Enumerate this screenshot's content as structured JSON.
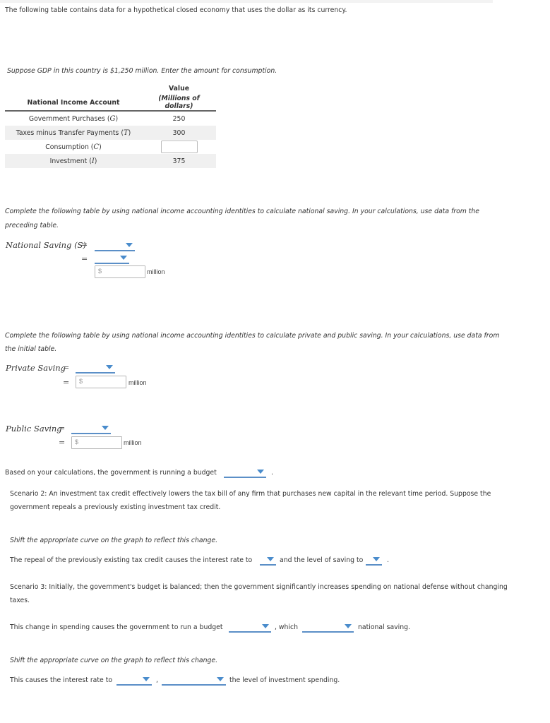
{
  "intro": "The following table contains data for a hypothetical closed economy that uses the dollar as its currency.",
  "gdp_prompt": "Suppose GDP in this country is $1,250 million. Enter the amount for consumption.",
  "table": {
    "header_col1": "National Income Account",
    "header_col2_line1": "Value",
    "header_col2_line2": "(Millions of dollars)",
    "rows": [
      {
        "label": "Government Purchases (",
        "sym": "G",
        "close": ")",
        "value": "250"
      },
      {
        "label": "Taxes minus Transfer Payments (",
        "sym": "T",
        "close": ")",
        "value": "300"
      },
      {
        "label": "Consumption (",
        "sym": "C",
        "close": ")",
        "value": ""
      },
      {
        "label": "Investment (",
        "sym": "I",
        "close": ")",
        "value": "375"
      }
    ]
  },
  "national_saving": {
    "instructions_line1": "Complete the following table by using national income accounting identities to calculate national saving. In your calculations, use data from the",
    "instructions_line2": "preceding table.",
    "label": "National Saving (S)",
    "equals": "=",
    "dollar": "$",
    "unit": "million",
    "input_value": ""
  },
  "private_public": {
    "instructions_line1": "Complete the following table by using national income accounting identities to calculate private and public saving. In your calculations, use data from",
    "instructions_line2": "the initial table.",
    "private_label": "Private Saving",
    "public_label": "Public Saving",
    "equals": "=",
    "dollar": "$",
    "unit": "million"
  },
  "budget": {
    "text": "Based on your calculations, the government is running a budget",
    "end": "."
  },
  "scenario2": {
    "line1": "Scenario 2: An investment tax credit effectively lowers the tax bill of any firm that purchases new capital in the relevant time period. Suppose the",
    "line2": "government repeals a previously existing investment tax credit.",
    "shift": "Shift the appropriate curve on the graph to reflect this change.",
    "sentence_a": "The repeal of the previously existing tax credit causes the interest rate to",
    "sentence_b": "and the level of saving to",
    "end": "."
  },
  "scenario3": {
    "line1": "Scenario 3: Initially, the government's budget is balanced; then the government significantly increases spending on national defense without changing",
    "line2": "taxes.",
    "sentence_a": "This change in spending causes the government to run a budget",
    "sentence_b": ", which",
    "sentence_c": "national saving.",
    "shift": "Shift the appropriate curve on the graph to reflect this change.",
    "sentence_d": "This causes the interest rate to",
    "sentence_e": ",",
    "sentence_f": "the level of investment spending."
  }
}
